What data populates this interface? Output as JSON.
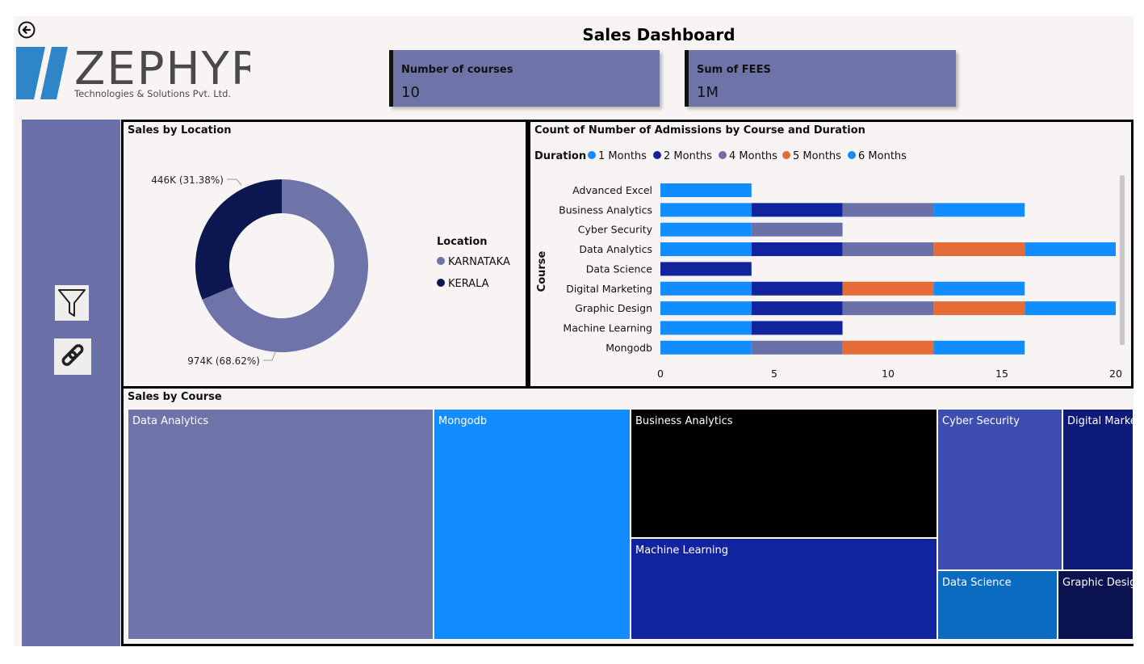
{
  "dashboard": {
    "title": "Sales Dashboard"
  },
  "logo": {
    "name": "ZEPHYR",
    "tagline": "Technologies & Solutions Pvt. Ltd."
  },
  "kpis": [
    {
      "label": "Number of courses",
      "value": "10"
    },
    {
      "label": "Sum of FEES",
      "value": "1M"
    }
  ],
  "sidebar": {
    "icons": [
      "filter-icon",
      "link-icon"
    ]
  },
  "donut": {
    "title": "Sales by Location",
    "legend_title": "Location",
    "slices": [
      {
        "name": "KARNATAKA",
        "value": 974,
        "label": "974K (68.62%)",
        "color": "#6e73a8"
      },
      {
        "name": "KERALA",
        "value": 446,
        "label": "446K (31.38%)",
        "color": "#0c1650"
      }
    ]
  },
  "chart_data": {
    "type": "bar",
    "orientation": "horizontal",
    "stacked": true,
    "title": "Count of Number of Admissions by Course and Duration",
    "legend_title": "Duration",
    "ylabel": "Course",
    "xlabel": "",
    "xlim": [
      0,
      20
    ],
    "xticks": [
      "0",
      "5",
      "10",
      "15",
      "20"
    ],
    "categories": [
      "Advanced Excel",
      "Business Analytics",
      "Cyber Security",
      "Data Analytics",
      "Data Science",
      "Digital Marketing",
      "Graphic Design",
      "Machine Learning",
      "Mongodb"
    ],
    "series": [
      {
        "name": "1 Months",
        "color": "#118dff",
        "values": [
          4,
          4,
          4,
          4,
          0,
          4,
          4,
          4,
          4
        ]
      },
      {
        "name": "2 Months",
        "color": "#12239e",
        "values": [
          0,
          4,
          0,
          4,
          4,
          4,
          4,
          4,
          0
        ]
      },
      {
        "name": "4 Months",
        "color": "#6b70a8",
        "values": [
          0,
          4,
          4,
          4,
          0,
          0,
          4,
          0,
          4
        ]
      },
      {
        "name": "5 Months",
        "color": "#e66c37",
        "values": [
          0,
          0,
          0,
          4,
          0,
          4,
          4,
          0,
          4
        ]
      },
      {
        "name": "6 Months",
        "color": "#118dff",
        "values": [
          0,
          4,
          0,
          4,
          0,
          4,
          4,
          0,
          4
        ]
      }
    ]
  },
  "treemap": {
    "title": "Sales by Course",
    "tiles": [
      {
        "name": "Data Analytics",
        "color": "#6e73a8"
      },
      {
        "name": "Mongodb",
        "color": "#118dff"
      },
      {
        "name": "Business Analytics",
        "color": "#000000"
      },
      {
        "name": "Machine Learning",
        "color": "#12239e"
      },
      {
        "name": "Cyber Security",
        "color": "#3e4db0"
      },
      {
        "name": "Digital Marketing",
        "color": "#0e1a78"
      },
      {
        "name": "Data Science",
        "color": "#0b6bc0"
      },
      {
        "name": "Graphic Design",
        "color": "#0a1250"
      }
    ]
  }
}
